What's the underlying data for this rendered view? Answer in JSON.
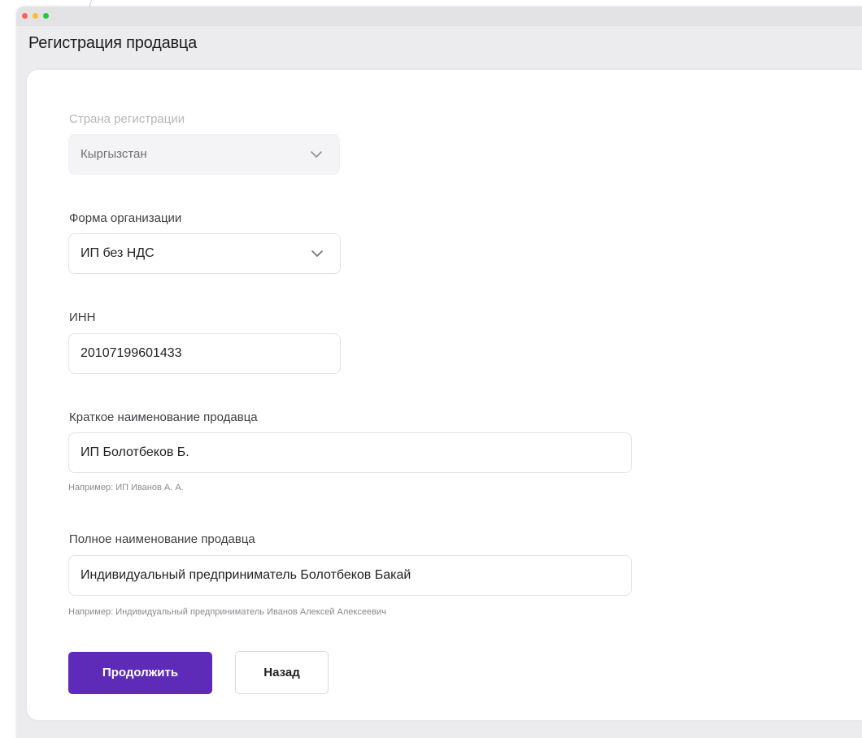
{
  "colors": {
    "primary": "#5d2bb8",
    "traffic_red": "#ff5f57",
    "traffic_yellow": "#febc2e",
    "traffic_green": "#28c840"
  },
  "page": {
    "title": "Регистрация продавца"
  },
  "form": {
    "country": {
      "label": "Страна регистрации",
      "value": "Кыргызстан",
      "icon": "chevron-down-icon",
      "disabled": true
    },
    "org_form": {
      "label": "Форма организации",
      "value": "ИП без НДС",
      "icon": "chevron-down-icon"
    },
    "inn": {
      "label": "ИНН",
      "value": "20107199601433"
    },
    "short_name": {
      "label": "Краткое наименование продавца",
      "value": "ИП Болотбеков Б.",
      "hint": "Например: ИП Иванов А. А."
    },
    "full_name": {
      "label": "Полное наименование продавца",
      "value": "Индивидуальный предприниматель Болотбеков Бакай",
      "hint": "Например: Индивидуальный предприниматель Иванов Алексей Алексеевич"
    }
  },
  "buttons": {
    "continue_label": "Продолжить",
    "back_label": "Назад"
  }
}
